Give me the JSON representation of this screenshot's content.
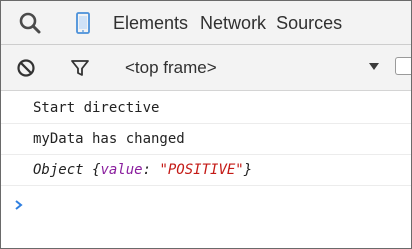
{
  "devtools": {
    "tabs": [
      "Elements",
      "Network",
      "Sources"
    ],
    "icons": {
      "search": "search-icon",
      "device": "device-mode-icon",
      "clear": "clear-console-icon",
      "filter": "filter-icon",
      "prompt": "console-prompt-chevron-icon"
    },
    "colors": {
      "toolbar_bg": "#f3f3f3",
      "device_icon": "#4a90d9",
      "object_key": "#8a1e9e",
      "object_value": "#c41a16",
      "prompt": "#2f7fe0"
    }
  },
  "toolbar": {
    "frame_selector": "<top frame>"
  },
  "console": {
    "messages": [
      {
        "text": "Start directive"
      },
      {
        "text": "myData has changed"
      }
    ],
    "object_message": {
      "prefix": "Object {",
      "key": "value",
      "colon": ": ",
      "value": "\"POSITIVE\"",
      "suffix": "}"
    }
  }
}
